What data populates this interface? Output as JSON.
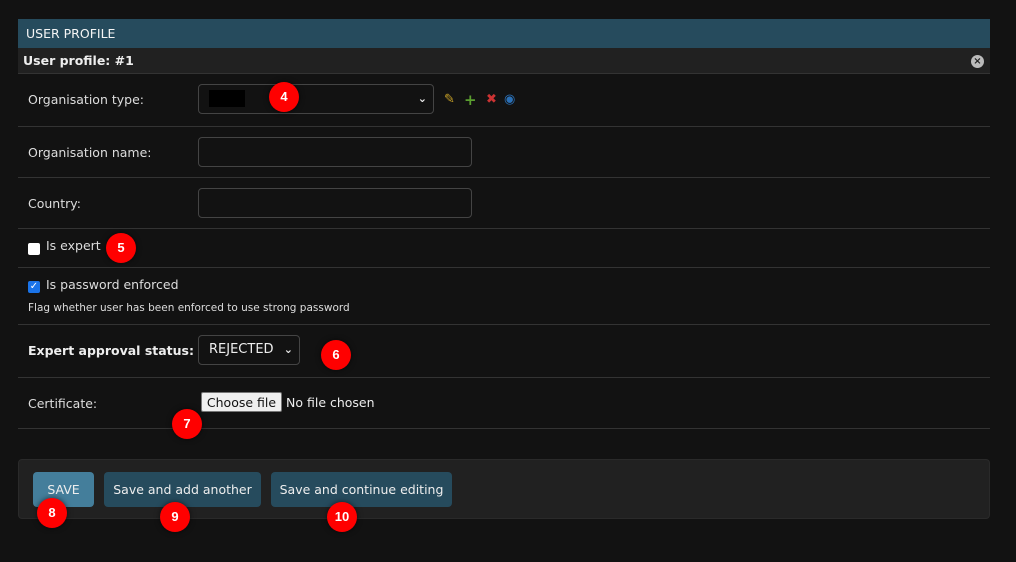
{
  "module": {
    "title": "USER PROFILE",
    "subtitle": "User profile: #1"
  },
  "fields": {
    "org_type": {
      "label": "Organisation type:",
      "value": ""
    },
    "org_name": {
      "label": "Organisation name:",
      "value": ""
    },
    "country": {
      "label": "Country:",
      "value": ""
    },
    "is_expert": {
      "label": "Is expert",
      "checked": false
    },
    "password_enforced": {
      "label": "Is password enforced",
      "checked": true,
      "help": "Flag whether user has been enforced to use strong password"
    },
    "approval": {
      "label": "Expert approval status:",
      "value": "REJECTED"
    },
    "certificate": {
      "label": "Certificate:",
      "button": "Choose file",
      "status": "No file chosen"
    }
  },
  "actions": {
    "save": "SAVE",
    "save_add": "Save and add another",
    "save_continue": "Save and continue editing"
  },
  "badges": [
    "4",
    "5",
    "6",
    "7",
    "8",
    "9",
    "10"
  ],
  "colors": {
    "header": "#264b5d",
    "badge": "#ff0000",
    "checkbox": "#1a73e8"
  }
}
